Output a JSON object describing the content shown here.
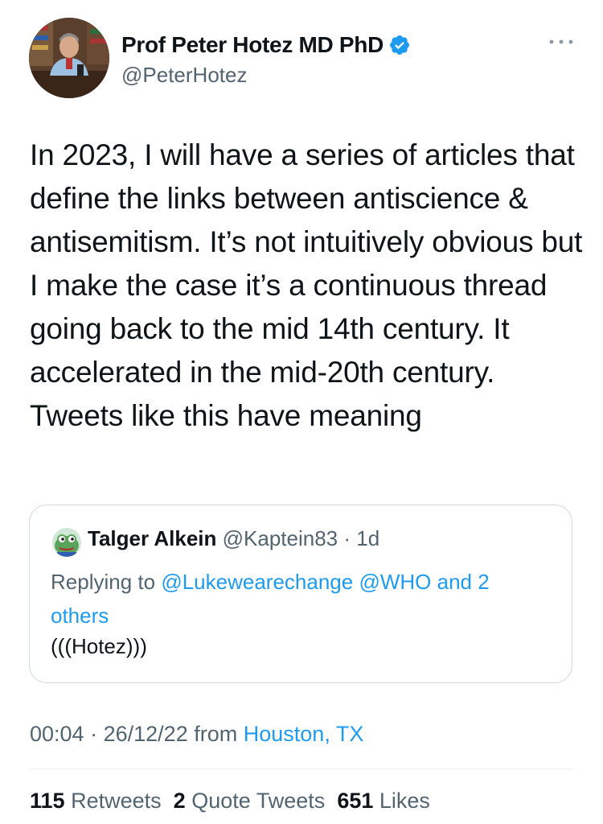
{
  "author": {
    "display_name": "Prof Peter Hotez MD PhD",
    "handle": "@PeterHotez",
    "verified": true,
    "avatar_icon": "profile-photo"
  },
  "menu": {
    "more_icon": "more-horizontal-icon"
  },
  "tweet": {
    "text": "In 2023, I will have a series of articles that define the links between antiscience & antisemitism. It’s not intuitively obvious but I make the case it’s a continuous thread going back to the mid 14th century. It accelerated in the mid-20th century. Tweets like this have meaning"
  },
  "quote": {
    "display_name": "Talger Alkein",
    "handle": "@Kaptein83",
    "separator": "·",
    "age": "1d",
    "replying_prefix": "Replying to",
    "replying_targets": [
      "@Lukewearechange",
      "@WHO"
    ],
    "replying_and": "and",
    "replying_others": "2 others",
    "text": "(((Hotez)))"
  },
  "meta": {
    "time": "00:04",
    "separator": "·",
    "date": "26/12/22",
    "from_label": "from",
    "location": "Houston, TX"
  },
  "stats": {
    "retweets_count": "115",
    "retweets_label": "Retweets",
    "quotes_count": "2",
    "quotes_label": "Quote Tweets",
    "likes_count": "651",
    "likes_label": "Likes"
  },
  "colors": {
    "text": "#0f1419",
    "secondary": "#536471",
    "link": "#1d9bf0",
    "border": "#cfd9de"
  }
}
